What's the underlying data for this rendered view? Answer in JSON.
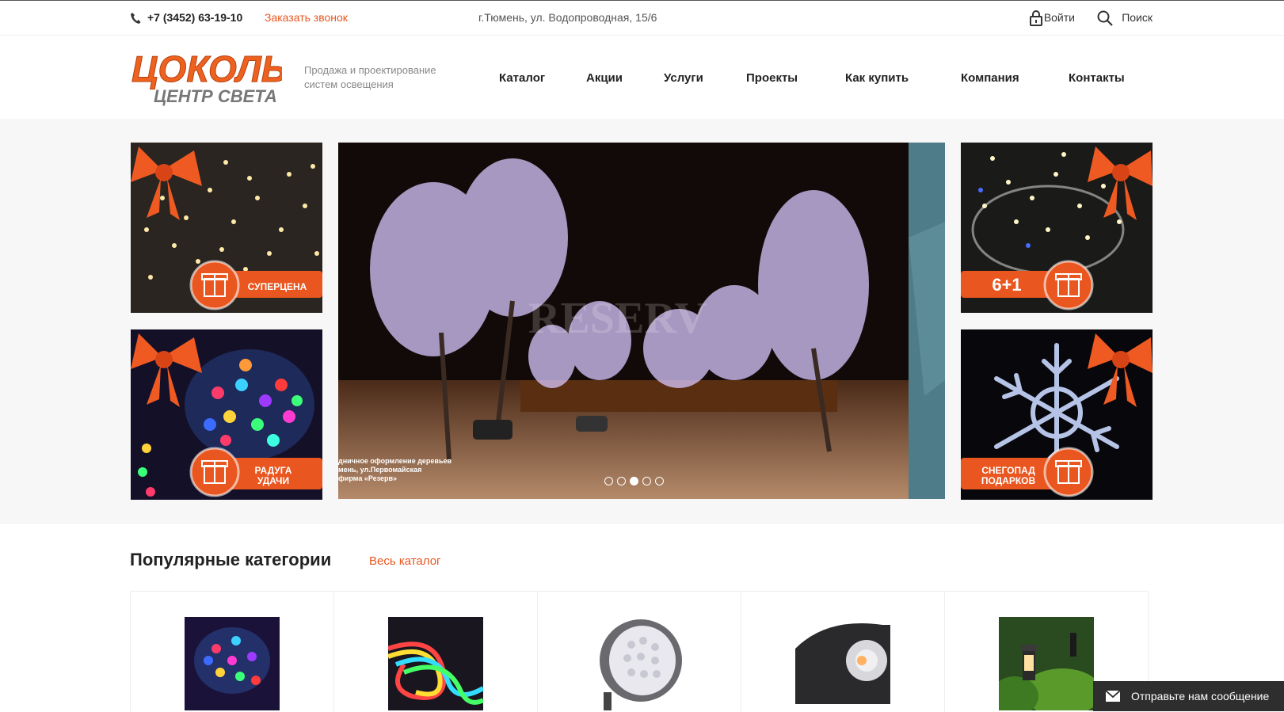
{
  "topbar": {
    "phone": "+7 (3452) 63-19-10",
    "callback": "Заказать звонок",
    "address": "г.Тюмень, ул. Водопроводная, 15/6",
    "login": "Войти",
    "search": "Поиск"
  },
  "header": {
    "logo_main": "ЦОКОЛЬ",
    "logo_sub": "ЦЕНТР СВЕТА",
    "tagline": "Продажа и проектирование систем освещения"
  },
  "nav": [
    "Каталог",
    "Акции",
    "Услуги",
    "Проекты",
    "Как купить",
    "Компания",
    "Контакты"
  ],
  "promos": [
    {
      "label": "СУПЕРЦЕНА"
    },
    {
      "label": "РАДУГА УДАЧИ"
    },
    {
      "label": "6+1"
    },
    {
      "label": "СНЕГОПАД ПОДАРКОВ"
    }
  ],
  "slider": {
    "caption_lines": [
      "дничное оформление деревьев",
      "мень, ул.Первомайская",
      "фирма «Резерв»"
    ],
    "watermark": "RESERV",
    "dots": 5,
    "active_dot": 3
  },
  "categories": {
    "title": "Популярные категории",
    "link": "Весь каталог"
  },
  "message": {
    "label": "Отправьте нам сообщение"
  },
  "colors": {
    "accent": "#e9561f",
    "dark": "#2e2e2e"
  }
}
